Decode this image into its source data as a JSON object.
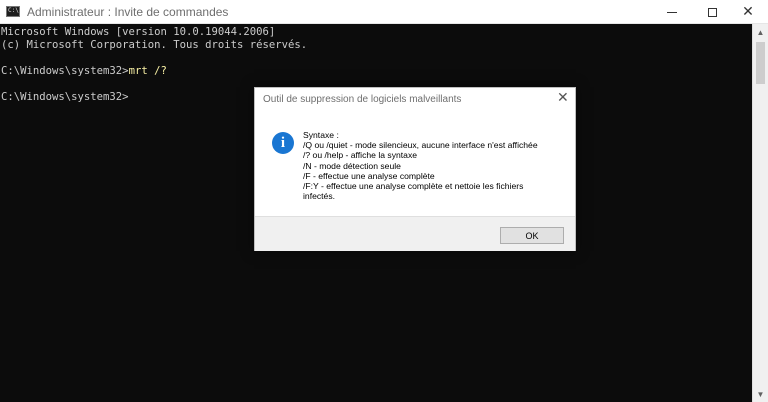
{
  "window": {
    "title": "Administrateur : Invite de commandes",
    "icon_text": "C:\\"
  },
  "console": {
    "lines": [
      "Microsoft Windows [version 10.0.19044.2006]",
      "(c) Microsoft Corporation. Tous droits réservés.",
      "",
      "C:\\Windows\\system32>",
      "",
      "C:\\Windows\\system32>"
    ],
    "command": "mrt /?",
    "command_color": "#f9f1a5",
    "text_color": "#cccccc",
    "background": "#0c0c0c"
  },
  "dialog": {
    "title": "Outil de suppression de logiciels malveillants",
    "icon": "info-icon",
    "message": [
      "Syntaxe :",
      "/Q ou /quiet - mode silencieux, aucune interface n'est affichée",
      "/? ou /help - affiche la syntaxe",
      "/N - mode détection seule",
      "/F - effectue une analyse complète",
      "/F:Y - effectue une analyse complète et nettoie les fichiers",
      "infectés."
    ],
    "ok_label": "OK"
  }
}
